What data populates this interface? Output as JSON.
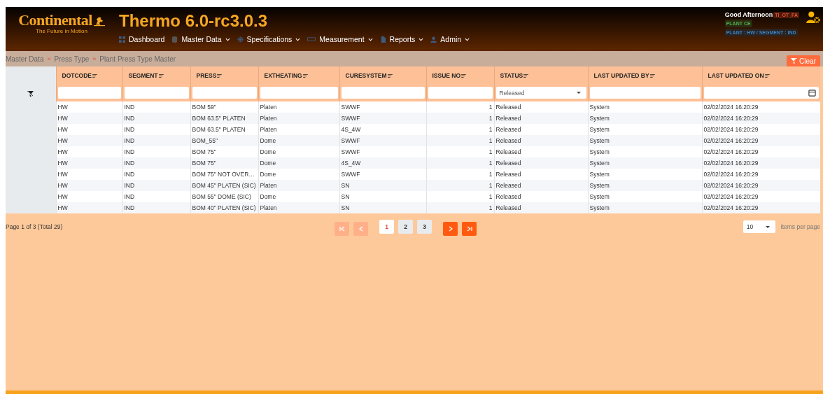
{
  "header": {
    "brand": "Continental",
    "tagline": "The Future in Motion",
    "app_title": "Thermo 6.0-rc3.0.3",
    "nav": [
      {
        "label": "Dashboard",
        "dropdown": false
      },
      {
        "label": "Master Data",
        "dropdown": true
      },
      {
        "label": "Specifications",
        "dropdown": true
      },
      {
        "label": "Measurement",
        "dropdown": true
      },
      {
        "label": "Reports",
        "dropdown": true
      },
      {
        "label": "Admin",
        "dropdown": true
      }
    ],
    "greeting": "Good Afternoon",
    "user": "TI_OT_FA",
    "plant": "PLANT CE",
    "scope": "PLANT : HW / SEGMENT : IND"
  },
  "breadcrumb": {
    "separator": "»",
    "items": [
      "Master Data",
      "Press Type",
      "Plant Press Type Master"
    ]
  },
  "clear_button": "Clear",
  "table": {
    "columns": [
      {
        "label": "DOTCODE"
      },
      {
        "label": "SEGMENT"
      },
      {
        "label": "PRESS"
      },
      {
        "label": "EXTHEATING"
      },
      {
        "label": "CURESYSTEM"
      },
      {
        "label": "ISSUE NO"
      },
      {
        "label": "STATUS",
        "filter_value": "Released"
      },
      {
        "label": "LAST UPDATED BY"
      },
      {
        "label": "LAST UPDATED ON"
      }
    ],
    "rows": [
      [
        "HW",
        "IND",
        "BOM 59\"",
        "Platen",
        "SWWF",
        "1",
        "Released",
        "System",
        "02/02/2024 16:20:29"
      ],
      [
        "HW",
        "IND",
        "BOM 63.5\" PLATEN",
        "Platen",
        "SWWF",
        "1",
        "Released",
        "System",
        "02/02/2024 16:20:29"
      ],
      [
        "HW",
        "IND",
        "BOM 63.5\" PLATEN",
        "Platen",
        "4S_4W",
        "1",
        "Released",
        "System",
        "02/02/2024 16:20:29"
      ],
      [
        "HW",
        "IND",
        "BOM_55\"",
        "Dome",
        "SWWF",
        "1",
        "Released",
        "System",
        "02/02/2024 16:20:29"
      ],
      [
        "HW",
        "IND",
        "BOM 75\"",
        "Dome",
        "SWWF",
        "1",
        "Released",
        "System",
        "02/02/2024 16:20:29"
      ],
      [
        "HW",
        "IND",
        "BOM 75\"",
        "Dome",
        "4S_4W",
        "1",
        "Released",
        "System",
        "02/02/2024 16:20:29"
      ],
      [
        "HW",
        "IND",
        "BOM 75\" NOT OVER…",
        "Dome",
        "SWWF",
        "1",
        "Released",
        "System",
        "02/02/2024 16:20:29"
      ],
      [
        "HW",
        "IND",
        "BOM 45\" PLATEN (SIC)",
        "Platen",
        "SN",
        "1",
        "Released",
        "System",
        "02/02/2024 16:20:29"
      ],
      [
        "HW",
        "IND",
        "BOM 55\" DOME (SIC)",
        "Dome",
        "SN",
        "1",
        "Released",
        "System",
        "02/02/2024 16:20:29"
      ],
      [
        "HW",
        "IND",
        "BOM 40\" PLATEN (SIC)",
        "Platen",
        "SN",
        "1",
        "Released",
        "System",
        "02/02/2024 16:20:29"
      ]
    ]
  },
  "pager": {
    "summary": "Page 1 of 3 (Total 29)",
    "controls": [
      {
        "kind": "first",
        "disabled": true
      },
      {
        "kind": "prev",
        "disabled": true
      }
    ],
    "pages": [
      {
        "label": "1",
        "selected": true
      },
      {
        "label": "2",
        "selected": false
      },
      {
        "label": "3",
        "selected": false
      }
    ],
    "controls_after": [
      {
        "kind": "next",
        "disabled": false
      },
      {
        "kind": "last",
        "disabled": false
      }
    ],
    "page_size": "10",
    "page_size_label": "items per page"
  }
}
